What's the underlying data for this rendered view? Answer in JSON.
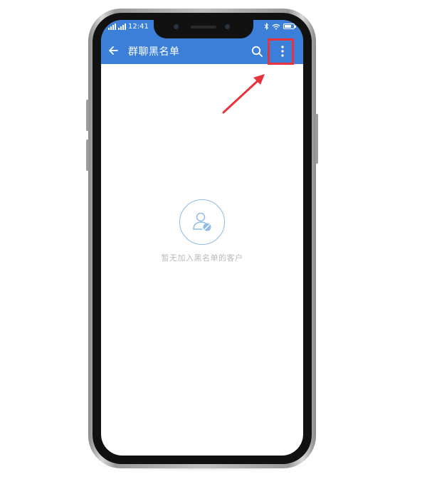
{
  "status_bar": {
    "time": "12:41"
  },
  "toolbar": {
    "title": "群聊黑名单",
    "back_icon": "arrow-left-icon",
    "search_icon": "search-icon",
    "more_icon": "more-vertical-icon"
  },
  "empty_state": {
    "icon": "user-blocked-icon",
    "message": "暂无加入黑名单的客户"
  },
  "colors": {
    "app_bar": "#3b7fd8",
    "highlight": "#e8323c",
    "empty_icon": "#8fbbe6",
    "empty_text": "#b8b8b8"
  }
}
